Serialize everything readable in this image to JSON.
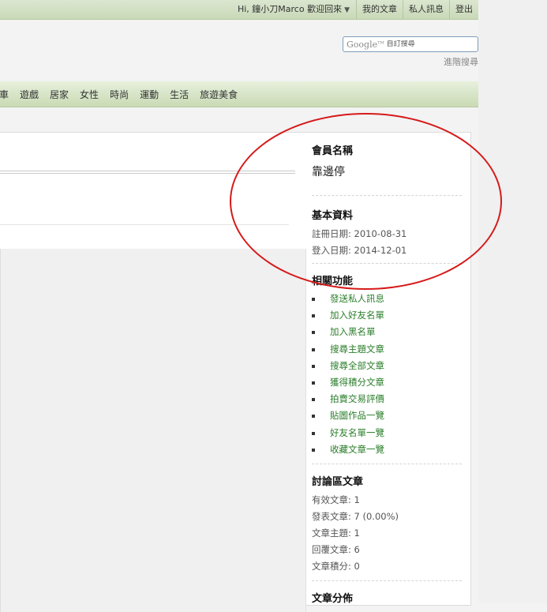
{
  "topbar": {
    "greeting": "Hi, 鐘小刀Marco 歡迎回來",
    "my_posts": "我的文章",
    "private_msg": "私人訊息",
    "logout": "登出",
    "arrow_icon": "caret-down-icon"
  },
  "search": {
    "logo": "Google",
    "placeholder": "自訂搜尋",
    "advanced": "進階搜尋"
  },
  "nav": {
    "items": [
      "車",
      "遊戲",
      "居家",
      "女性",
      "時尚",
      "運動",
      "生活",
      "旅遊美食"
    ]
  },
  "profile": {
    "member_name_heading": "會員名稱",
    "member_name": "靠邊停",
    "basic_heading": "基本資料",
    "register_date": "註冊日期: 2010-08-31",
    "login_date": "登入日期: 2014-12-01",
    "functions_heading": "相關功能",
    "functions": [
      "發送私人訊息",
      "加入好友名單",
      "加入黑名單",
      "搜尋主題文章",
      "搜尋全部文章",
      "獲得積分文章",
      "拍賣交易評價",
      "貼圖作品一覽",
      "好友名單一覽",
      "收藏文章一覽"
    ],
    "forum_heading": "討論區文章",
    "valid_posts": "有效文章: 1",
    "published_posts": "發表文章: 7 (0.00%)",
    "topics": "文章主題: 1",
    "replies": "回覆文章: 6",
    "points": "文章積分: 0",
    "distribution_heading": "文章分佈"
  },
  "colors": {
    "annotation_oval": "#d61a1a",
    "nav_bg": "#c9dab4",
    "link_green": "#2a7d2a"
  }
}
